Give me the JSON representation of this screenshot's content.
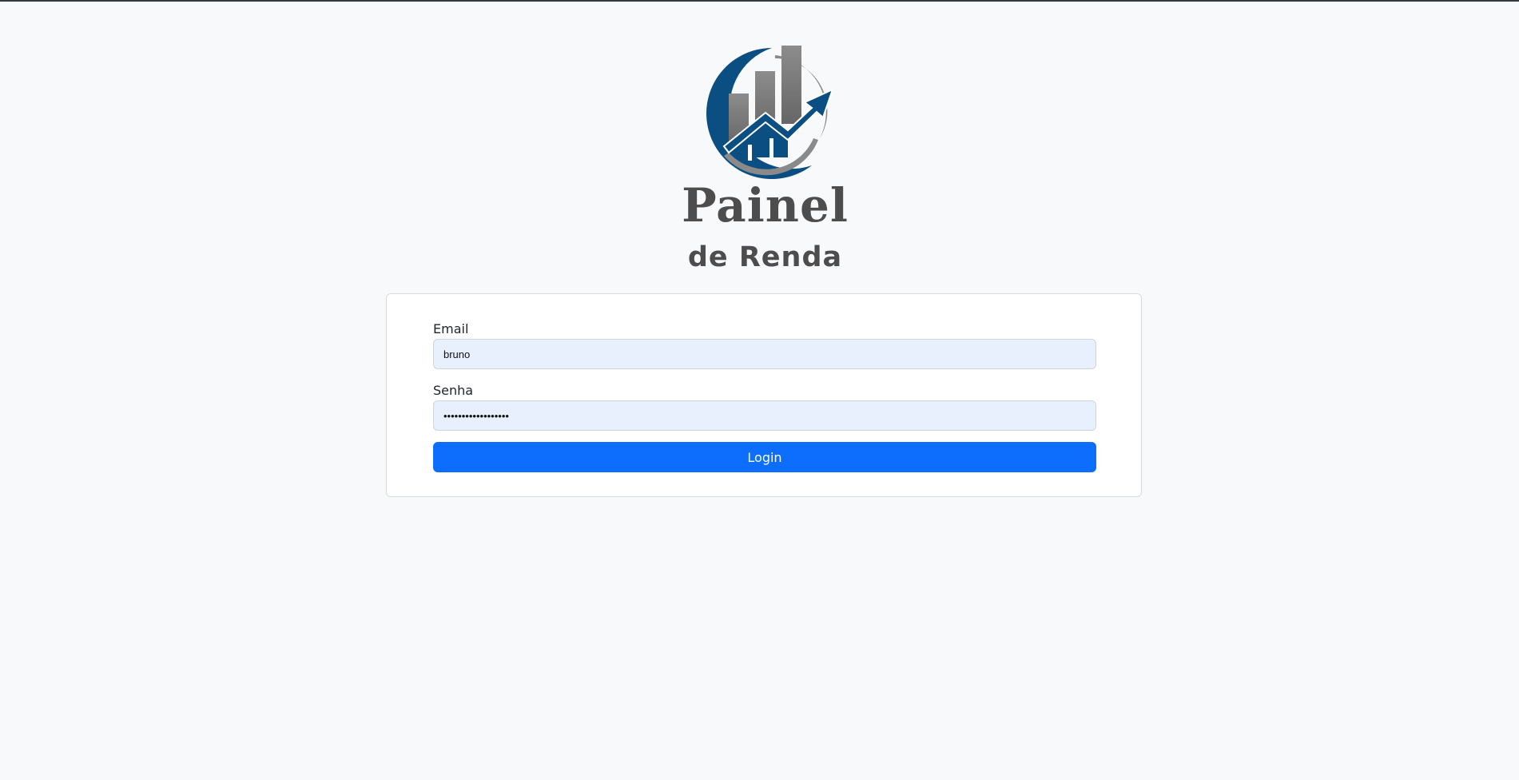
{
  "brand": {
    "logo_icon": "bar-chart-growth-arrow-icon",
    "title": "Painel",
    "subtitle": "de Renda",
    "colors": {
      "navy": "#0b4f82",
      "gray": "#7d7d7d",
      "text": "#4d4d4d"
    }
  },
  "login_form": {
    "email_label": "Email",
    "email_value": "bruno",
    "password_label": "Senha",
    "password_value": "••••••••••••••••••",
    "submit_label": "Login",
    "button_color": "#0d6efd"
  }
}
